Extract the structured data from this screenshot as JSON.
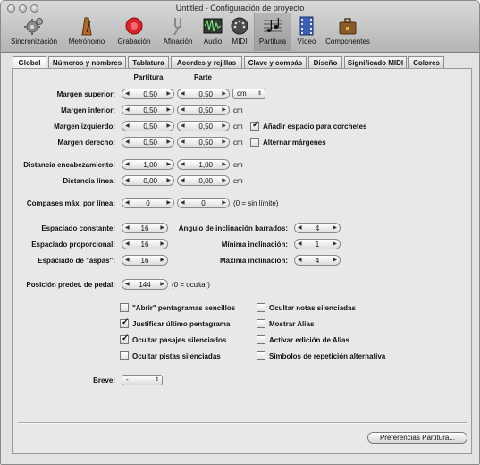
{
  "window": {
    "title": "Untitled - Configuración de proyecto"
  },
  "toolbar": {
    "items": [
      {
        "label": "Sincronización",
        "icon": "gear-icon"
      },
      {
        "label": "Metrónomo",
        "icon": "metronome-icon"
      },
      {
        "label": "Grabación",
        "icon": "record-icon"
      },
      {
        "label": "Afinación",
        "icon": "tuning-fork-icon"
      },
      {
        "label": "Audio",
        "icon": "audio-waveform-icon"
      },
      {
        "label": "MIDI",
        "icon": "midi-connector-icon"
      },
      {
        "label": "Partitura",
        "icon": "score-notes-icon"
      },
      {
        "label": "Vídeo",
        "icon": "film-strip-icon"
      },
      {
        "label": "Componentes",
        "icon": "briefcase-icon"
      }
    ],
    "selected": "Partitura"
  },
  "tabs": [
    "Global",
    "Números y nombres",
    "Tablatura",
    "Acordes y rejillas",
    "Clave y compás",
    "Diseño",
    "Significado MIDI",
    "Colores"
  ],
  "active_tab": "Global",
  "margins": {
    "col_score": "Partitura",
    "col_part": "Parte",
    "unit_popup": "cm",
    "unit": "cm",
    "rows": [
      {
        "label": "Margen superior:",
        "score": "0,50",
        "part": "0,50"
      },
      {
        "label": "Margen inferior:",
        "score": "0,50",
        "part": "0,50"
      },
      {
        "label": "Margen izquierdo:",
        "score": "0,50",
        "part": "0,50"
      },
      {
        "label": "Margen derecho:",
        "score": "0,50",
        "part": "0,50"
      }
    ],
    "add_bracket_space": {
      "label": "Añadir espacio para corchetes",
      "checked": true
    },
    "alternate_margins": {
      "label": "Alternar márgenes",
      "checked": false
    }
  },
  "distances": {
    "rows": [
      {
        "label": "Distancia encabezamiento:",
        "score": "1,00",
        "part": "1,00"
      },
      {
        "label": "Distancia línea:",
        "score": "0,00",
        "part": "0,00"
      }
    ]
  },
  "max_bars": {
    "label": "Compases máx. por línea:",
    "score": "0",
    "part": "0",
    "note": "(0 = sin límite)"
  },
  "spacing": {
    "constant": {
      "label": "Espaciado constante:",
      "value": "16"
    },
    "proportional": {
      "label": "Espaciado proporcional:",
      "value": "16"
    },
    "aspas": {
      "label": "Espaciado de \"aspas\":",
      "value": "16"
    },
    "beam_angle": {
      "label": "Ángulo de inclinación barrados:",
      "value": "4"
    },
    "min_slope": {
      "label": "Mínima inclinación:",
      "value": "1"
    },
    "max_slope": {
      "label": "Máxima inclinación:",
      "value": "4"
    }
  },
  "pedal": {
    "label": "Posición predet. de pedal:",
    "value": "144",
    "note": "(0 = ocultar)"
  },
  "checkboxes_left": [
    {
      "label": "\"Abrir\" pentagramas sencillos",
      "checked": false
    },
    {
      "label": "Justificar último pentagrama",
      "checked": true
    },
    {
      "label": "Ocultar pasajes silenciados",
      "checked": true
    },
    {
      "label": "Ocultar pistas silenciadas",
      "checked": false
    }
  ],
  "checkboxes_right": [
    {
      "label": "Ocultar notas silenciadas",
      "checked": false
    },
    {
      "label": "Mostrar Alias",
      "checked": false
    },
    {
      "label": "Activar edición de Alias",
      "checked": false
    },
    {
      "label": "Símbolos de repetición alternativa",
      "checked": false
    }
  ],
  "breve": {
    "label": "Breve:",
    "value": "-"
  },
  "footer": {
    "button_label": "Preferencias Partitura..."
  },
  "glyphs": {
    "check": "✓",
    "left_arrow": "◀",
    "right_arrow": "▶",
    "updown": "⇕"
  }
}
